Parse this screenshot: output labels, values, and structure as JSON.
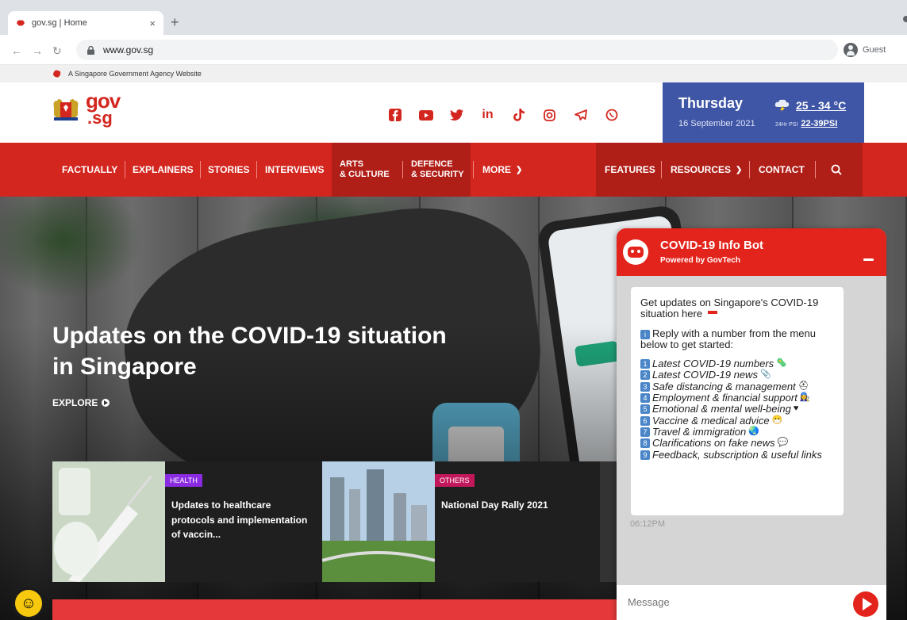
{
  "browser": {
    "tab_title": "gov.sg | Home",
    "tab_close": "×",
    "new_tab": "+",
    "url": "www.gov.sg",
    "profile_label": "Guest"
  },
  "agency_banner": "A Singapore Government Agency Website",
  "logo": {
    "line1": "gov",
    "line2": ".sg"
  },
  "social": [
    {
      "icon": "facebook-icon",
      "glyph": "f"
    },
    {
      "icon": "youtube-icon",
      "glyph": "▶"
    },
    {
      "icon": "twitter-icon",
      "glyph": "🐦"
    },
    {
      "icon": "linkedin-icon",
      "glyph": "in"
    },
    {
      "icon": "tiktok-icon",
      "glyph": "♪"
    },
    {
      "icon": "instagram-icon",
      "glyph": "◎"
    },
    {
      "icon": "telegram-icon",
      "glyph": "➤"
    },
    {
      "icon": "whatsapp-icon",
      "glyph": "✆"
    }
  ],
  "weather": {
    "day": "Thursday",
    "date": "16 September 2021",
    "temp": "25 - 34 °C",
    "psi_label": "24Hr PSI",
    "psi_value": "22-39PSI"
  },
  "nav": {
    "factually": "FACTUALLY",
    "explainers": "EXPLAINERS",
    "stories": "STORIES",
    "interviews": "INTERVIEWS",
    "arts_1": "ARTS",
    "arts_2": "& CULTURE",
    "defence_1": "DEFENCE",
    "defence_2": "& SECURITY",
    "more": "MORE",
    "features": "FEATURES",
    "resources": "RESOURCES",
    "contact": "CONTACT"
  },
  "hero": {
    "title": "Updates on the COVID-19 situation in Singapore",
    "explore": "EXPLORE"
  },
  "cards": [
    {
      "tag": "HEALTH",
      "tag_color": "#8a2be2",
      "caption": "Updates to healthcare protocols and implementation of vaccin..."
    },
    {
      "tag": "OTHERS",
      "tag_color": "#c2185b",
      "caption": "National Day Rally 2021"
    }
  ],
  "chat": {
    "title": "COVID-19 Info Bot",
    "subtitle": "Powered by GovTech",
    "intro": "Get updates on Singapore's COVID-19 situation here",
    "reply": "Reply with a number from the menu below to get started:",
    "menu": [
      {
        "n": "1",
        "label": "Latest COVID-19 numbers",
        "emoji": "🦠"
      },
      {
        "n": "2",
        "label": "Latest COVID-19 news",
        "emoji": "📎"
      },
      {
        "n": "3",
        "label": "Safe distancing & management",
        "emoji": "⛑"
      },
      {
        "n": "4",
        "label": "Employment & financial support",
        "emoji": "👩‍🔧"
      },
      {
        "n": "5",
        "label": "Emotional & mental well-being",
        "emoji": "♥"
      },
      {
        "n": "6",
        "label": "Vaccine & medical advice",
        "emoji": "😷"
      },
      {
        "n": "7",
        "label": "Travel & immigration",
        "emoji": "🌏"
      },
      {
        "n": "8",
        "label": "Clarifications on fake news",
        "emoji": "💬"
      },
      {
        "n": "9",
        "label": "Feedback, subscription & useful links",
        "emoji": ""
      }
    ],
    "timestamp": "06:12PM",
    "message_placeholder": "Message"
  },
  "colors": {
    "brand_red": "#d3261f",
    "weather_blue": "#3f56a6"
  }
}
